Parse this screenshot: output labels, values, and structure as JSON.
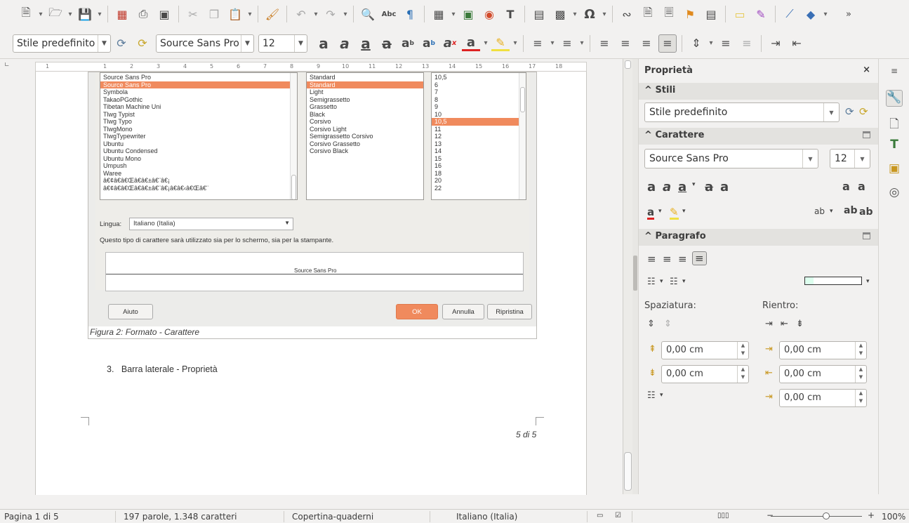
{
  "toolbar_standard": {
    "icons": [
      "new-document-icon",
      "open-icon",
      "save-icon",
      "export-pdf-icon",
      "print-icon",
      "print-preview-icon",
      "cut-icon",
      "copy-icon",
      "paste-icon",
      "clone-formatting-icon",
      "undo-icon",
      "redo-icon",
      "find-replace-icon",
      "spelling-icon",
      "formatting-marks-icon",
      "table-icon",
      "image-icon",
      "chart-icon",
      "text-box-icon",
      "page-break-icon",
      "field-icon",
      "special-character-icon",
      "hyperlink-icon",
      "footnote-icon",
      "endnote-icon",
      "bookmark-icon",
      "cross-reference-icon",
      "comment-icon",
      "track-changes-icon",
      "line-icon",
      "shapes-icon",
      "more-icon"
    ],
    "omega_glyph": "Ω",
    "more_glyph": "»",
    "abc_glyph": "Abc"
  },
  "toolbar_formatting": {
    "style_value": "Stile predefinito",
    "font_value": "Source Sans Pro",
    "size_value": "12"
  },
  "ruler": {
    "ticks": [
      "1",
      "1",
      "2",
      "3",
      "4",
      "5",
      "6",
      "7",
      "8",
      "9",
      "10",
      "11",
      "12",
      "13",
      "14",
      "15",
      "16",
      "17",
      "18"
    ]
  },
  "dialog": {
    "font_list": [
      "Source Sans Pro",
      "Source Sans Pro",
      "Symbola",
      "TakaoPGothic",
      "Tibetan Machine Uni",
      "Tlwg Typist",
      "Tlwg Typo",
      "TlwgMono",
      "TlwgTypewriter",
      "Ubuntu",
      "Ubuntu Condensed",
      "Ubuntu Mono",
      "Umpush",
      "Waree",
      "â€¢â€â€Œâ€â€±â€¨â€¡",
      "â€¢â€â€Œâ€â€±â€¨â€¡â€â€‹â€Œâ€¨"
    ],
    "style_list": [
      "Standard",
      "Standard",
      "Light",
      "Semigrassetto",
      "Grassetto",
      "Black",
      "Corsivo",
      "Corsivo Light",
      "Semigrassetto Corsivo",
      "Corsivo Grassetto",
      "Corsivo Black"
    ],
    "size_list": [
      "10,5",
      "6",
      "7",
      "8",
      "9",
      "10",
      "10,5",
      "11",
      "12",
      "13",
      "14",
      "15",
      "16",
      "18",
      "20",
      "22"
    ],
    "lingua_label": "Lingua:",
    "lingua_value": "Italiano (Italia)",
    "info_text": "Questo tipo di carattere sarà utilizzato sia per lo schermo, sia per la stampante.",
    "preview_text": "Source Sans Pro",
    "btn_help": "Aiuto",
    "btn_ok": "OK",
    "btn_cancel": "Annulla",
    "btn_reset": "Ripristina"
  },
  "document": {
    "caption": "Figura 2: Formato - Carattere",
    "heading_number": "3.",
    "heading_text": "Barra laterale - Proprietà",
    "page_number": "5 di 5"
  },
  "sidebar": {
    "title": "Proprietà",
    "close_glyph": "×",
    "sections": {
      "stili": "Stili",
      "carattere": "Carattere",
      "paragrafo": "Paragrafo"
    },
    "style_value": "Stile predefinito",
    "font_value": "Source Sans Pro",
    "size_value": "12",
    "spaziatura_label": "Spaziatura:",
    "rientro_label": "Rientro:",
    "above_spacing": "0,00 cm",
    "below_spacing": "0,00 cm",
    "before_indent": "0,00 cm",
    "after_indent": "0,00 cm",
    "first_line_indent": "0,00 cm"
  },
  "statusbar": {
    "page": "Pagina 1 di 5",
    "words": "197 parole, 1.348 caratteri",
    "page_style": "Copertina-quaderni",
    "language": "Italiano (Italia)",
    "zoom": "100%"
  },
  "colors": {
    "accent_orange": "#f08a5d",
    "panel_bg": "#f2f1f0",
    "section_bg": "#e3e2df"
  }
}
